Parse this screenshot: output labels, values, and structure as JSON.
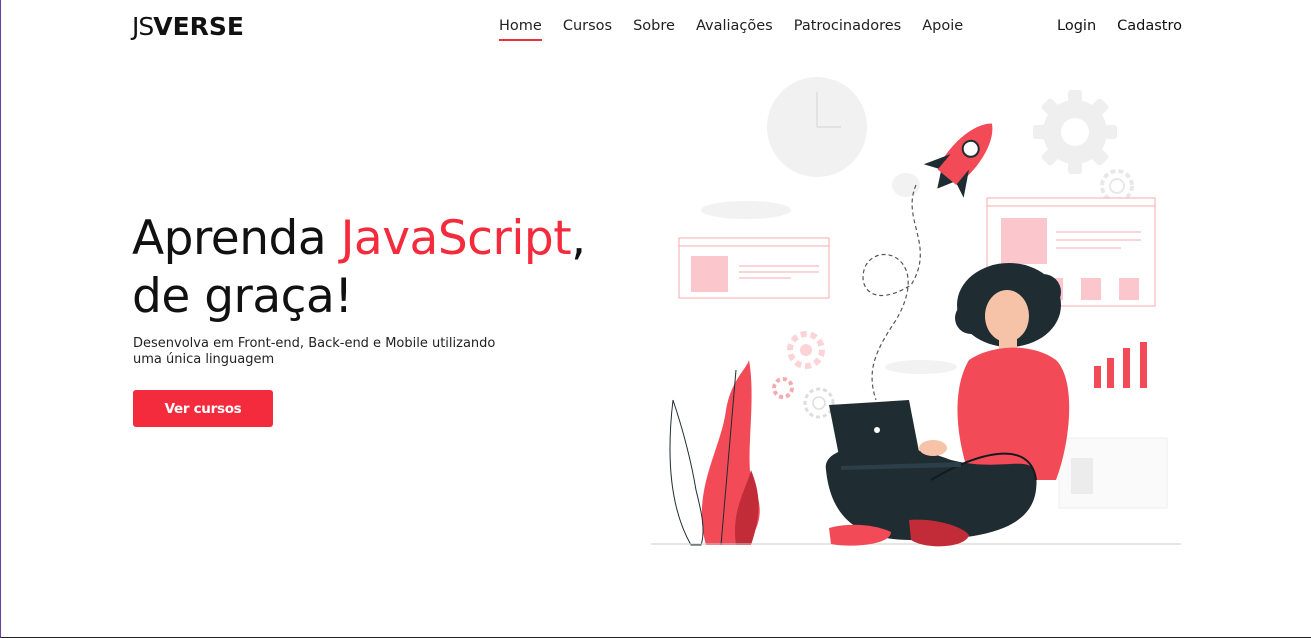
{
  "brand": {
    "logo_prefix": "JS",
    "logo_suffix": "VERSE"
  },
  "nav": {
    "items": [
      {
        "label": "Home",
        "active": true
      },
      {
        "label": "Cursos",
        "active": false
      },
      {
        "label": "Sobre",
        "active": false
      },
      {
        "label": "Avaliações",
        "active": false
      },
      {
        "label": "Patrocinadores",
        "active": false
      },
      {
        "label": "Apoie",
        "active": false
      }
    ]
  },
  "auth": {
    "login_label": "Login",
    "signup_label": "Cadastro"
  },
  "hero": {
    "title_part1": "Aprenda ",
    "title_accent": "JavaScript",
    "title_part2": ",",
    "title_line2": "de graça!",
    "subtitle": "Desenvolva em Front-end, Back-end e Mobile utilizando uma única linguagem",
    "cta_label": "Ver cursos"
  },
  "colors": {
    "accent": "#f42b3c",
    "dark": "#1f2d33",
    "light_pink": "#fbc7cc"
  },
  "illustration": {
    "icons": [
      "clock-icon",
      "gear-icon",
      "rocket-icon",
      "bar-chart-icon",
      "laptop-icon",
      "plant-icon"
    ]
  }
}
